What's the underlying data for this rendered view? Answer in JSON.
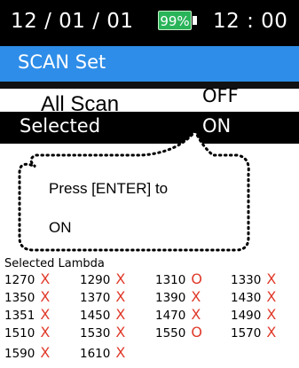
{
  "status_bar": {
    "date": "12 / 01 / 01",
    "battery_percent": "99%",
    "time": "12 : 00"
  },
  "title": "SCAN Set",
  "menu": {
    "all_scan_label": "All Scan",
    "all_scan_value": "OFF",
    "selected_label": "Selected",
    "selected_value": "ON"
  },
  "popup": {
    "line1": "Press [ENTER] to",
    "line2": "ON"
  },
  "lambda": {
    "title": "Selected Lambda",
    "items": [
      {
        "wavelength": "1270",
        "mark": "X"
      },
      {
        "wavelength": "1290",
        "mark": "X"
      },
      {
        "wavelength": "1310",
        "mark": "O"
      },
      {
        "wavelength": "1330",
        "mark": "X"
      },
      {
        "wavelength": "1350",
        "mark": "X"
      },
      {
        "wavelength": "1370",
        "mark": "X"
      },
      {
        "wavelength": "1390",
        "mark": "X"
      },
      {
        "wavelength": "1430",
        "mark": "X"
      },
      {
        "wavelength": "1351",
        "mark": "X"
      },
      {
        "wavelength": "1450",
        "mark": "X"
      },
      {
        "wavelength": "1470",
        "mark": "X"
      },
      {
        "wavelength": "1490",
        "mark": "X"
      },
      {
        "wavelength": "1510",
        "mark": "X"
      },
      {
        "wavelength": "1530",
        "mark": "X"
      },
      {
        "wavelength": "1550",
        "mark": "O"
      },
      {
        "wavelength": "1570",
        "mark": "X"
      },
      {
        "wavelength": "1590",
        "mark": "X"
      },
      {
        "wavelength": "1610",
        "mark": "X"
      }
    ]
  },
  "colors": {
    "title_bar": "#2e8de8",
    "battery": "#2ab45a",
    "mark": "#e03a2a"
  }
}
